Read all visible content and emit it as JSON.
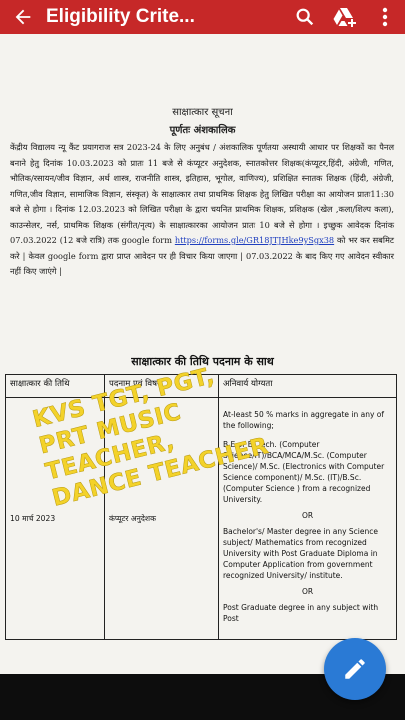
{
  "appbar": {
    "title": "Eligibility Crite...",
    "icons": [
      "arrow-back-icon",
      "search-icon",
      "drive-add-icon",
      "more-vert-icon"
    ]
  },
  "document": {
    "heading": "साक्षात्कार सूचना",
    "subheading": "पूर्णतः अंशकालिक",
    "paragraph_before_link": "केंद्रीय विद्यालय न्यू कैंट प्रयागराज सत्र 2023-24 के लिए अनुबंध / अंशकालिक पूर्णतया अस्थायी आधार पर शिक्षकों का पैनल बनाने हेतु दिनांक 10.03.2023 को प्रातः 11 बजे से कंप्यूटर अनुदेशक, स्नातकोत्तर शिक्षक(कंप्यूटर,हिंदी, अंग्रेजी, गणित, भौतिक/रसायन/जीव विज्ञान, अर्थ शास्त्र, राजनीति शास्त्र, इतिहास, भूगोल, वाणिज्य), प्रशिक्षित स्नातक शिक्षक (हिंदी, अंग्रेजी, गणित,जीव विज्ञान, सामाजिक विज्ञान, संस्कृत) के साक्षात्कार तथा प्राथमिक शिक्षक हेतु लिखित परीक्षा का आयोजन प्रातः11:30 बजे से होगा । दिनांक 12.03.2023 को लिखित परीक्षा के द्वारा चयनित प्राथमिक शिक्षक, प्रशिक्षक (खेल ,कला/शिल्प कला), काउन्सेलर, नर्स, प्राथमिक शिक्षक (संगीत/नृत्य) के साक्षात्कारका आयोजन प्रातः 10 बजे से होगा । इच्छुक आवेदक दिनांक 07.03.2022 (12 बजे रात्रि) तक google form ",
    "link_text": "https://forms.gle/GR18JTJHke9ySgx38",
    "paragraph_after_link": " को भर कर सबमिट करे | केवल google form द्वारा प्राप्त आवेदन पर ही विचार किया जाएगा | 07.03.2022 के बाद किए गए आवेदन स्वीकार नहीं किए जाएंगे |",
    "schedule_heading": "साक्षात्कार की तिथि पदनाम के साथ",
    "table": {
      "headers": [
        "साक्षात्कार की तिथि",
        "पदनाम एवं विषय",
        "अनिवार्य योग्यता"
      ],
      "row": {
        "date": "10 मार्च 2023",
        "post": "कंप्यूटर अनुदेशक",
        "eligibility": [
          "At-least 50 % marks in aggregate in any of the following;",
          "B.E or B. Tech. (Computer Science/IT)/BCA/MCA/M.Sc. (Computer Science)/ M.Sc. (Electronics with Computer Science component)/ M.Sc. (IT)/B.Sc. (Computer Science ) from a recognized University.",
          "OR",
          "Bachelor's/ Master degree in any Science subject/ Mathematics from recognized University with Post Graduate Diploma in Computer Application from government recognized University/ institute.",
          "OR",
          "Post Graduate degree in any subject with Post"
        ]
      }
    }
  },
  "overlay_text": [
    "KVS TGT, PGT,",
    "PRT MUSIC",
    "TEACHER,",
    "DANCE TEACHER"
  ],
  "fab": {
    "icon": "edit-pencil-icon"
  },
  "colors": {
    "appbar": "#c62828",
    "fab": "#2a7ad5",
    "overlay": "#f3d22a",
    "link": "#1f3fbf"
  }
}
